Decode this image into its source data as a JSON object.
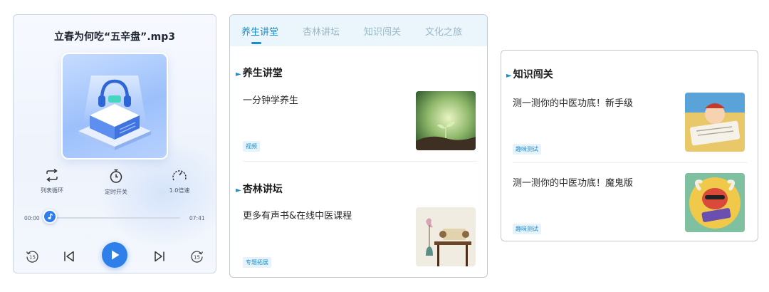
{
  "player": {
    "title": "立春为何吃“五辛盘”.mp3",
    "controls": [
      {
        "label": "列表循环",
        "icon": "loop-icon"
      },
      {
        "label": "定时开关",
        "icon": "timer-icon"
      },
      {
        "label": "1.0倍速",
        "icon": "speed-gauge-icon"
      }
    ],
    "current_time": "00:00",
    "total_time": "07:41",
    "progress": 0.0,
    "rewind_label": "15",
    "forward_label": "15",
    "accent_color": "#2f7fea"
  },
  "lecture": {
    "tabs": [
      {
        "label": "养生讲堂",
        "active": true
      },
      {
        "label": "杏林讲坛",
        "active": false
      },
      {
        "label": "知识闯关",
        "active": false
      },
      {
        "label": "文化之旅",
        "active": false
      }
    ],
    "sections": [
      {
        "title": "养生讲堂",
        "card_title": "一分钟学养生",
        "tag": "视频",
        "thumb": "seedling-image"
      },
      {
        "title": "杏林讲坛",
        "card_title": "更多有声书&在线中医课程",
        "tag": "专题拓展",
        "thumb": "scroll-vase-image"
      }
    ],
    "accent_color": "#1b8fce"
  },
  "quiz": {
    "title": "知识闯关",
    "items": [
      {
        "title": "测一测你的中医功底！新手级",
        "tag": "趣味测试",
        "thumb": "cartoon-scholar-image"
      },
      {
        "title": "测一测你的中医功底！魔鬼版",
        "tag": "趣味测试",
        "thumb": "cartoon-ox-image"
      }
    ]
  }
}
